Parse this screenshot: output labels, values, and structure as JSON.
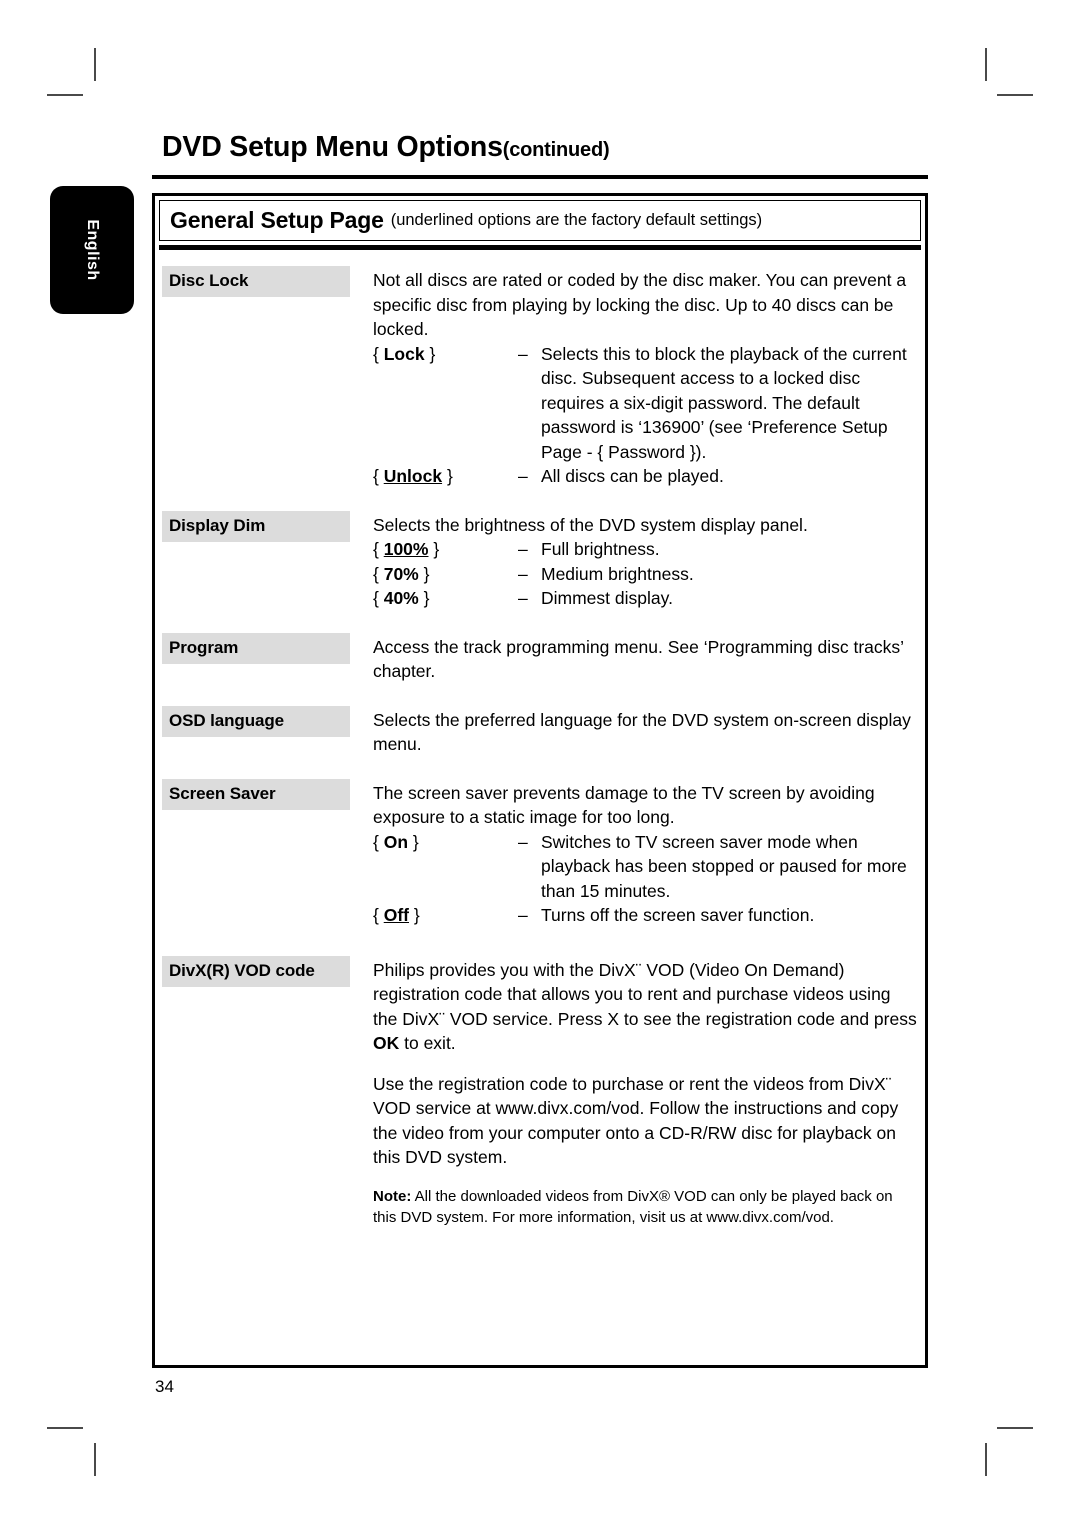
{
  "crop_marks": {
    "present": true
  },
  "header": {
    "title_main": "DVD Setup Menu Options",
    "title_continued": "(continued)"
  },
  "language_tab": {
    "label": "English"
  },
  "section": {
    "header_title": "General Setup Page",
    "header_note": "(underlined options are the factory default settings)"
  },
  "colors": {
    "label_chip_bg": "#dcdcdc",
    "tab_bg": "#000000",
    "tab_text": "#ffffff",
    "rule": "#000000"
  },
  "rows": [
    {
      "label": "Disc Lock",
      "body": "Not all discs are rated or coded by the disc maker.  You can prevent a specific disc from playing by locking the disc.  Up to 40 discs can be locked.",
      "options": [
        {
          "open": "{",
          "name": "Lock",
          "close": "}",
          "underlined": false,
          "dash": "–",
          "desc": "Selects this to block the playback of the current disc.  Subsequent access to a locked disc requires a six-digit password.  The default password is ‘136900’ (see ‘Preference Setup Page - { Password })."
        },
        {
          "open": "{",
          "name": "Unlock",
          "close": "}",
          "underlined": true,
          "dash": "–",
          "desc": "All discs can be played."
        }
      ]
    },
    {
      "label": "Display Dim",
      "body": "Selects the brightness of the DVD system display panel.",
      "options": [
        {
          "open": "{",
          "name": "100%",
          "close": "}",
          "underlined": true,
          "dash": "–",
          "desc": "Full brightness."
        },
        {
          "open": "{",
          "name": "70%",
          "close": "}",
          "underlined": false,
          "dash": "–",
          "desc": "Medium brightness."
        },
        {
          "open": "{",
          "name": "40%",
          "close": "}",
          "underlined": false,
          "dash": "–",
          "desc": "Dimmest display."
        }
      ]
    },
    {
      "label": "Program",
      "body": "Access the track programming menu.  See ‘Programming disc tracks’ chapter.",
      "options": []
    },
    {
      "label": "OSD language",
      "body": "Selects the preferred language for the DVD system on-screen display menu.",
      "options": []
    },
    {
      "label": "Screen Saver",
      "body": "The screen saver prevents damage to the TV screen by avoiding exposure to a static image for too long.",
      "options": [
        {
          "open": "{",
          "name": "On",
          "close": "}",
          "underlined": false,
          "dash": "–",
          "desc": "Switches to TV screen saver mode when playback has been stopped or paused for more than 15 minutes."
        },
        {
          "open": "{",
          "name": "Off",
          "close": "}",
          "underlined": true,
          "dash": "–",
          "desc": "Turns off the screen saver function."
        }
      ]
    }
  ],
  "divx": {
    "label": "DivX(R) VOD code",
    "para1_a": "Philips provides you with the DivX",
    "para1_tm": "¨",
    "para1_b": " VOD (Video On Demand) registration code that allows you to rent and purchase videos using the DivX",
    "para1_c": " VOD service.  Press  X to see the registration code and press ",
    "para1_ok": "OK",
    "para1_d": " to exit.",
    "para2_a": "Use the registration code to purchase or rent the videos from DivX",
    "para2_b": " VOD service at www.divx.com/vod.  Follow the instructions and copy the video from your computer onto a CD-R/RW disc for playback on this DVD system.",
    "note_label": "Note:",
    "note_body": "  All the downloaded videos from DivX® VOD can only be played back on this DVD system.  For more information, visit us at www.divx.com/vod."
  },
  "footer": {
    "page_number": "34"
  }
}
